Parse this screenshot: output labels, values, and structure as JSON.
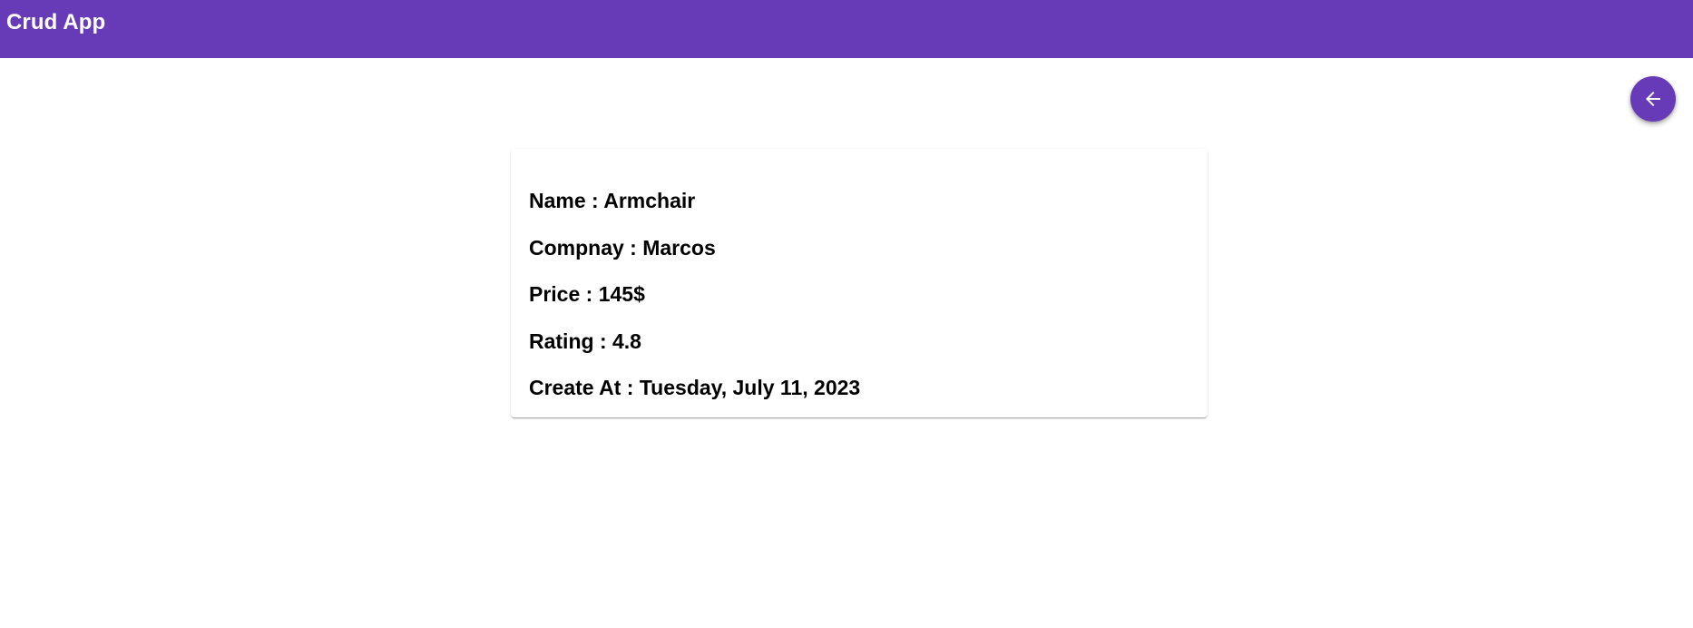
{
  "header": {
    "title": "Crud App"
  },
  "back_button": {
    "icon": "arrow-left-icon"
  },
  "details": {
    "name": "Name : Armchair",
    "company": "Compnay : Marcos",
    "price": "Price : 145$",
    "rating": "Rating : 4.8",
    "created_at": "Create At : Tuesday, July 11, 2023"
  },
  "colors": {
    "primary": "#673ab7",
    "on_primary": "#ffffff",
    "text": "#000000",
    "background": "#ffffff"
  }
}
